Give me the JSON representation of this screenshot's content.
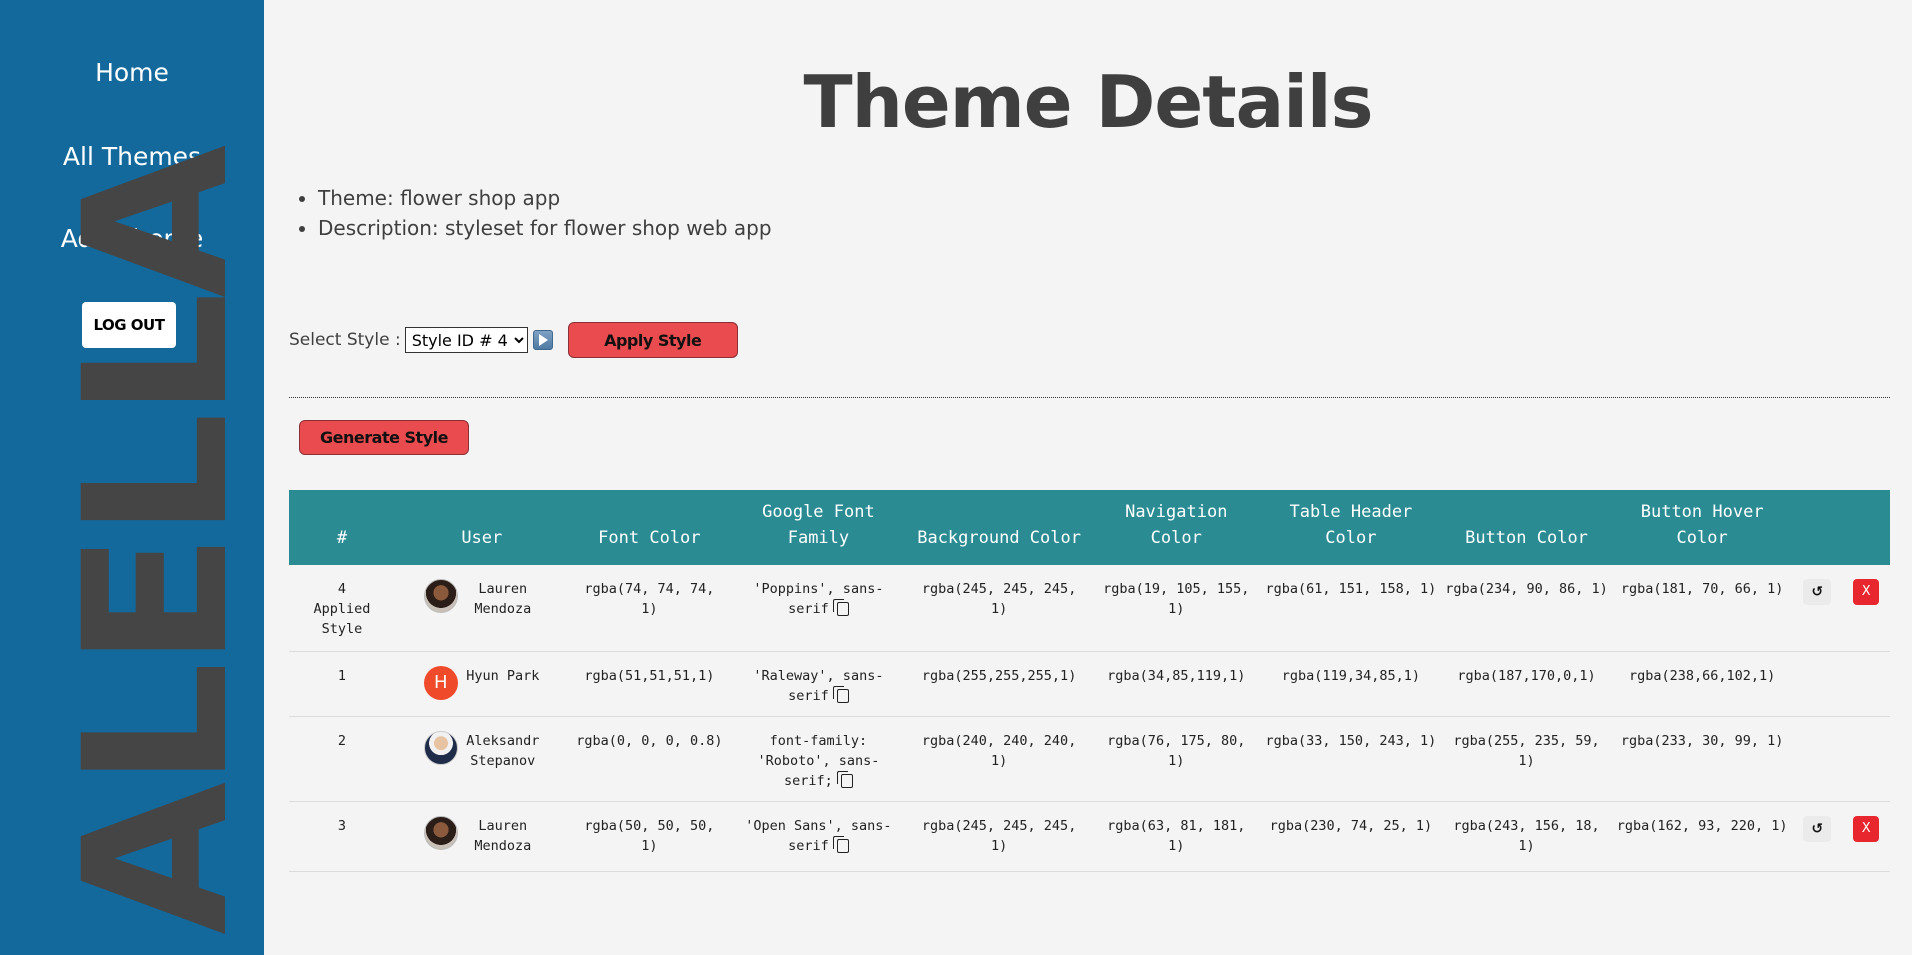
{
  "sidebar": {
    "nav": [
      "Home",
      "All Themes",
      "Add Theme"
    ],
    "logout_label": "LOG OUT",
    "brand": "ALELLA"
  },
  "main": {
    "title": "Theme Details",
    "theme_line": "Theme: flower shop app",
    "description_line": "Description: styleset for flower shop web app",
    "select_label": "Select Style :",
    "select_value": "Style ID # 4",
    "apply_label": "Apply Style",
    "generate_label": "Generate Style"
  },
  "table": {
    "headers": [
      "#",
      "User",
      "Font Color",
      "Google Font Family",
      "Background Color",
      "Navigation Color",
      "Table Header Color",
      "Button Color",
      "Button Hover Color"
    ],
    "rows": [
      {
        "id": "4",
        "note": "Applied Style",
        "user": "Lauren Mendoza",
        "avatar": "photo-woman",
        "font_color": "rgba(74, 74, 74, 1)",
        "font_family": "'Poppins', sans-serif",
        "background": "rgba(245, 245, 245, 1)",
        "navigation": "rgba(19, 105, 155, 1)",
        "table_header": "rgba(61, 151, 158, 1)",
        "button": "rgba(234, 90, 86, 1)",
        "button_hover": "rgba(181, 70, 66, 1)",
        "reset_icon": "↺",
        "delete_label": "X"
      },
      {
        "id": "1",
        "note": "",
        "user": "Hyun Park",
        "avatar": "letter",
        "avatar_letter": "H",
        "font_color": "rgba(51,51,51,1)",
        "font_family": "'Raleway', sans-serif",
        "background": "rgba(255,255,255,1)",
        "navigation": "rgba(34,85,119,1)",
        "table_header": "rgba(119,34,85,1)",
        "button": "rgba(187,170,0,1)",
        "button_hover": "rgba(238,66,102,1)"
      },
      {
        "id": "2",
        "note": "",
        "user": "Aleksandr Stepanov",
        "avatar": "photo-man",
        "font_color": "rgba(0, 0, 0, 0.8)",
        "font_family": "font-family: 'Roboto', sans-serif;",
        "background": "rgba(240, 240, 240, 1)",
        "navigation": "rgba(76, 175, 80, 1)",
        "table_header": "rgba(33, 150, 243, 1)",
        "button": "rgba(255, 235, 59, 1)",
        "button_hover": "rgba(233, 30, 99, 1)"
      },
      {
        "id": "3",
        "note": "",
        "user": "Lauren Mendoza",
        "avatar": "photo-woman",
        "font_color": "rgba(50, 50, 50, 1)",
        "font_family": "'Open Sans', sans-serif",
        "background": "rgba(245, 245, 245, 1)",
        "navigation": "rgba(63, 81, 181, 1)",
        "table_header": "rgba(230, 74, 25, 1)",
        "button": "rgba(243, 156, 18, 1)",
        "button_hover": "rgba(162, 93, 220, 1)",
        "reset_icon": "↺",
        "delete_label": "X"
      }
    ]
  },
  "colors": {
    "sidebar": "#13699b",
    "table_header": "#2b8b93",
    "button": "#e94b4f",
    "delete": "#e8262e"
  }
}
